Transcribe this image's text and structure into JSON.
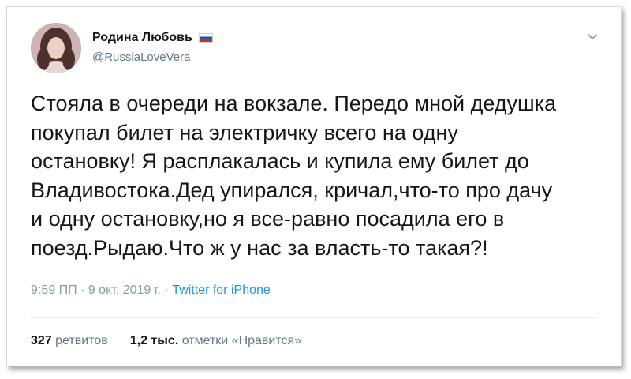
{
  "author": {
    "display_name": "Родина Любовь",
    "handle": "@RussiaLoveVera",
    "flag_icon": "russia-flag-icon"
  },
  "tweet": {
    "text": "Стояла в очереди на вокзале. Передо мной дедушка\nпокупал билет на электричку всего на одну\nостановку! Я расплакалась и купила ему билет до\nВладивостока.Дед упирался, кричал,что-то про дачу\nи одну остановку,но я все-равно посадила его в\nпоезд.Рыдаю.Что ж у нас за власть-то такая?!",
    "time": "9:59 ПП",
    "date": "9 окт. 2019 г.",
    "sep": "·",
    "source": "Twitter for iPhone"
  },
  "stats": {
    "retweets_count": "327",
    "retweets_label": "ретвитов",
    "likes_count": "1,2 тыс.",
    "likes_label": "отметки «Нравится»"
  },
  "colors": {
    "text": "#14171a",
    "muted": "#8899a6",
    "link": "#1b95e0"
  }
}
